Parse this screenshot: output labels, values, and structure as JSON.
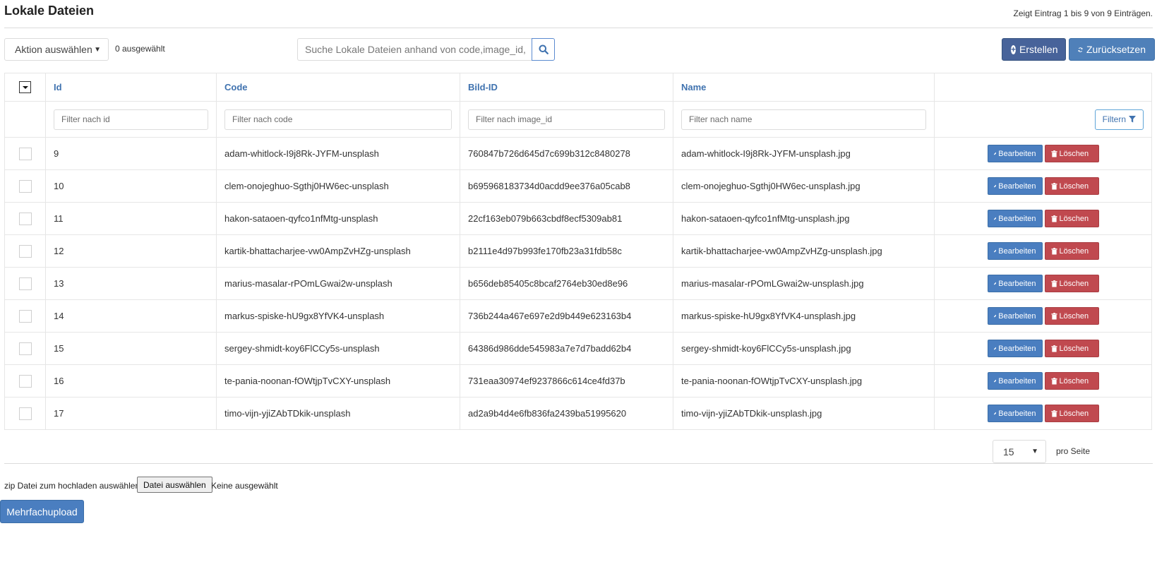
{
  "header": {
    "title": "Lokale Dateien",
    "entry_info": "Zeigt Eintrag 1 bis 9 von 9 Einträgen."
  },
  "toolbar": {
    "action_select": "Aktion auswählen",
    "selected_count": "0 ausgewählt",
    "search_placeholder": "Suche Lokale Dateien anhand von code,image_id,name",
    "create_label": "Erstellen",
    "reset_label": "Zurücksetzen"
  },
  "table": {
    "columns": [
      "Id",
      "Code",
      "Bild-ID",
      "Name"
    ],
    "filters": {
      "id": "Filter nach id",
      "code": "Filter nach code",
      "image_id": "Filter nach image_id",
      "name": "Filter nach name",
      "button": "Filtern"
    },
    "edit_label": "Bearbeiten",
    "delete_label": "Löschen",
    "rows": [
      {
        "id": "9",
        "code": "adam-whitlock-I9j8Rk-JYFM-unsplash",
        "image_id": "760847b726d645d7c699b312c8480278",
        "name": "adam-whitlock-I9j8Rk-JYFM-unsplash.jpg"
      },
      {
        "id": "10",
        "code": "clem-onojeghuo-Sgthj0HW6ec-unsplash",
        "image_id": "b695968183734d0acdd9ee376a05cab8",
        "name": "clem-onojeghuo-Sgthj0HW6ec-unsplash.jpg"
      },
      {
        "id": "11",
        "code": "hakon-sataoen-qyfco1nfMtg-unsplash",
        "image_id": "22cf163eb079b663cbdf8ecf5309ab81",
        "name": "hakon-sataoen-qyfco1nfMtg-unsplash.jpg"
      },
      {
        "id": "12",
        "code": "kartik-bhattacharjee-vw0AmpZvHZg-unsplash",
        "image_id": "b2111e4d97b993fe170fb23a31fdb58c",
        "name": "kartik-bhattacharjee-vw0AmpZvHZg-unsplash.jpg"
      },
      {
        "id": "13",
        "code": "marius-masalar-rPOmLGwai2w-unsplash",
        "image_id": "b656deb85405c8bcaf2764eb30ed8e96",
        "name": "marius-masalar-rPOmLGwai2w-unsplash.jpg"
      },
      {
        "id": "14",
        "code": "markus-spiske-hU9gx8YfVK4-unsplash",
        "image_id": "736b244a467e697e2d9b449e623163b4",
        "name": "markus-spiske-hU9gx8YfVK4-unsplash.jpg"
      },
      {
        "id": "15",
        "code": "sergey-shmidt-koy6FlCCy5s-unsplash",
        "image_id": "64386d986dde545983a7e7d7badd62b4",
        "name": "sergey-shmidt-koy6FlCCy5s-unsplash.jpg"
      },
      {
        "id": "16",
        "code": "te-pania-noonan-fOWtjpTvCXY-unsplash",
        "image_id": "731eaa30974ef9237866c614ce4fd37b",
        "name": "te-pania-noonan-fOWtjpTvCXY-unsplash.jpg"
      },
      {
        "id": "17",
        "code": "timo-vijn-yjiZAbTDkik-unsplash",
        "image_id": "ad2a9b4d4e6fb836fa2439ba51995620",
        "name": "timo-vijn-yjiZAbTDkik-unsplash.jpg"
      }
    ]
  },
  "pager": {
    "per_page_value": "15",
    "per_page_label": "pro Seite"
  },
  "upload": {
    "label": "zip Datei zum hochladen auswählen",
    "file_button": "Datei auswählen",
    "file_status": "Keine ausgewählt",
    "multi_upload_label": "Mehrfachupload"
  },
  "colors": {
    "primary": "#4a7ec0",
    "create": "#47639a",
    "danger": "#c0494f",
    "header_text": "#3f72af"
  },
  "icons": [
    "search-icon",
    "plus-circle-icon",
    "refresh-icon",
    "filter-icon",
    "pencil-icon",
    "trash-icon",
    "chevron-down-icon"
  ]
}
